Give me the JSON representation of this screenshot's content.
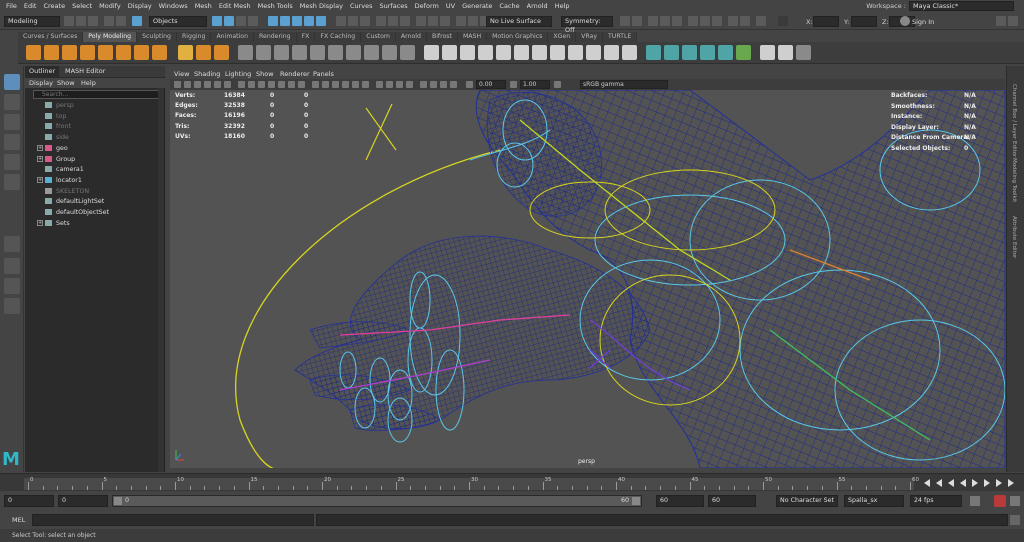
{
  "menubar": {
    "items": [
      "File",
      "Edit",
      "Create",
      "Select",
      "Modify",
      "Display",
      "Windows",
      "Mesh",
      "Edit Mesh",
      "Mesh Tools",
      "Mesh Display",
      "Curves",
      "Surfaces",
      "Deform",
      "UV",
      "Generate",
      "Cache",
      "Arnold",
      "Help"
    ],
    "workspace_label": "Workspace :",
    "workspace_value": "Maya Classic*"
  },
  "statusline": {
    "mode": "Modeling",
    "objects": "Objects",
    "live_surface": "No Live Surface",
    "symmetry": "Symmetry: Off",
    "x_label": "X:",
    "y_label": "Y:",
    "z_label": "Z:",
    "sign_in": "Sign In"
  },
  "shelf": {
    "tabs": [
      "Curves / Surfaces",
      "Poly Modeling",
      "Sculpting",
      "Rigging",
      "Animation",
      "Rendering",
      "FX",
      "FX Caching",
      "Custom",
      "Arnold",
      "Bifrost",
      "MASH",
      "Motion Graphics",
      "XGen",
      "VRay",
      "TURTLE"
    ],
    "active_tab": "Poly Modeling"
  },
  "outliner": {
    "tabs": [
      "Outliner",
      "MASH Editor"
    ],
    "menu": [
      "Display",
      "Show",
      "Help"
    ],
    "search_placeholder": "Search...",
    "items": [
      {
        "label": "persp",
        "dim": true,
        "expand": false
      },
      {
        "label": "top",
        "dim": true,
        "expand": false
      },
      {
        "label": "front",
        "dim": true,
        "expand": false
      },
      {
        "label": "side",
        "dim": true,
        "expand": false
      },
      {
        "label": "geo",
        "dim": false,
        "expand": true
      },
      {
        "label": "Group",
        "dim": false,
        "expand": true
      },
      {
        "label": "camera1",
        "dim": false,
        "expand": false
      },
      {
        "label": "locator1",
        "dim": false,
        "expand": true
      },
      {
        "label": "SKELETON",
        "dim": true,
        "expand": false
      },
      {
        "label": "defaultLightSet",
        "dim": false,
        "expand": false
      },
      {
        "label": "defaultObjectSet",
        "dim": false,
        "expand": false
      },
      {
        "label": "Sets",
        "dim": false,
        "expand": true
      }
    ]
  },
  "viewport": {
    "menu": [
      "View",
      "Shading",
      "Lighting",
      "Show",
      "Renderer",
      "Panels"
    ],
    "field1": "0.00",
    "field2": "1.00",
    "color_space": "sRGB gamma",
    "camera": "persp",
    "hud_left": [
      {
        "label": "Verts:",
        "v1": "16384",
        "v2": "0",
        "v3": "0"
      },
      {
        "label": "Edges:",
        "v1": "32538",
        "v2": "0",
        "v3": "0"
      },
      {
        "label": "Faces:",
        "v1": "16196",
        "v2": "0",
        "v3": "0"
      },
      {
        "label": "Tris:",
        "v1": "32392",
        "v2": "0",
        "v3": "0"
      },
      {
        "label": "UVs:",
        "v1": "18160",
        "v2": "0",
        "v3": "0"
      }
    ],
    "hud_right": [
      {
        "label": "Backfaces:",
        "value": "N/A"
      },
      {
        "label": "Smoothness:",
        "value": "N/A"
      },
      {
        "label": "Instance:",
        "value": "N/A"
      },
      {
        "label": "Display Layer:",
        "value": "N/A"
      },
      {
        "label": "Distance From Camera:",
        "value": "N/A"
      },
      {
        "label": "Selected Objects:",
        "value": "0"
      }
    ]
  },
  "right_tabs": [
    "Channel Box / Layer Editor",
    "Modeling Toolkit",
    "Attribute Editor"
  ],
  "timeslider": {
    "ticks": [
      "0",
      "5",
      "10",
      "15",
      "20",
      "25",
      "30",
      "35",
      "40",
      "45",
      "50",
      "55",
      "60"
    ]
  },
  "rangeslider": {
    "start": "0",
    "anim_start": "0",
    "range_start": "0",
    "range_end": "60",
    "anim_end": "60",
    "end": "60",
    "character_set": "No Character Set",
    "anim_layer": "Spalla_sx",
    "fps": "24 fps"
  },
  "cmdline": {
    "label": "MEL"
  },
  "helpline": {
    "text": "Select Tool: select an object"
  }
}
